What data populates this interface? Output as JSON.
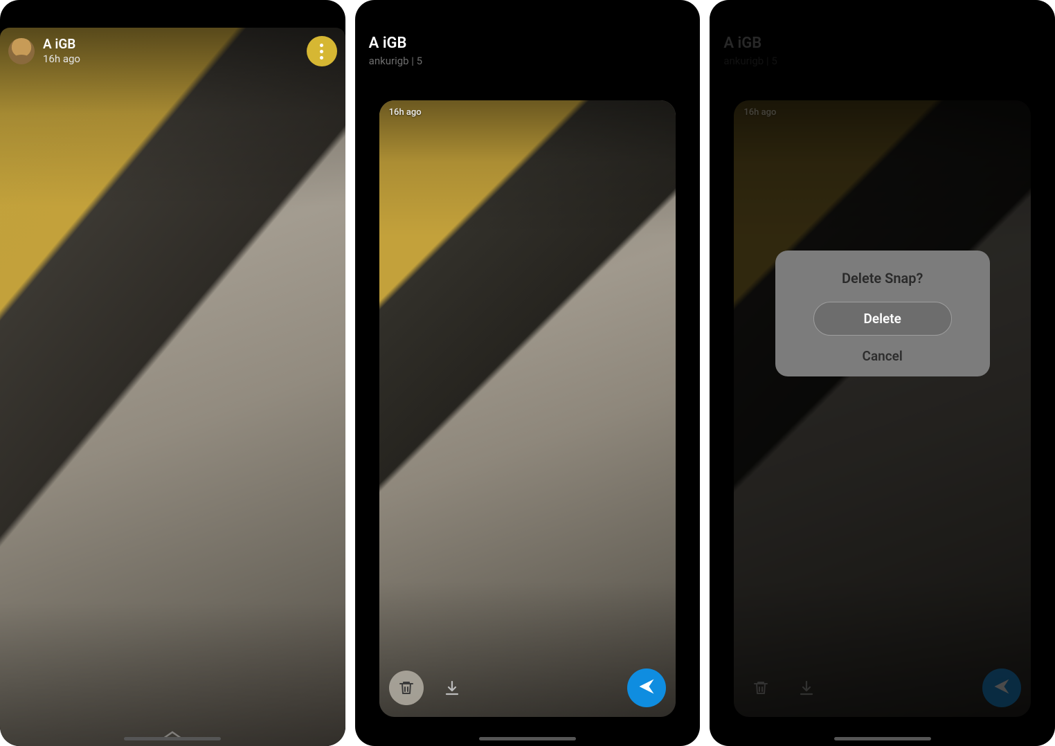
{
  "screen1": {
    "name": "A iGB",
    "time": "16h ago"
  },
  "screen2": {
    "name": "A iGB",
    "subtitle": "ankurigb | 5",
    "snap_time": "16h ago"
  },
  "screen3": {
    "name": "A iGB",
    "subtitle": "ankurigb | 5",
    "snap_time": "16h ago",
    "dialog_title": "Delete Snap?",
    "delete_label": "Delete",
    "cancel_label": "Cancel"
  }
}
